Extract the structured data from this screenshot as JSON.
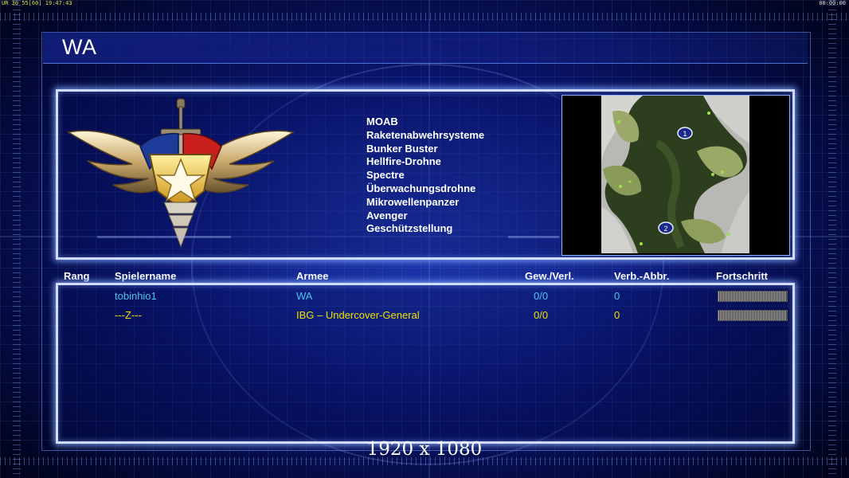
{
  "hud": {
    "top_left": "UR 30 55[60] 19:47:43",
    "top_right": "00:00:00"
  },
  "title": "WA",
  "emblem_icon": "usa-general-wings-emblem",
  "tech_list": [
    "MOAB",
    "Raketenabwehrsysteme",
    "Bunker Buster",
    "Hellfire-Drohne",
    "Spectre",
    "Überwachungsdrohne",
    "Mikrowellenpanzer",
    "Avenger",
    "Geschützstellung"
  ],
  "map": {
    "start_positions": [
      "1",
      "2"
    ]
  },
  "table": {
    "headers": {
      "rank": "Rang",
      "player": "Spielername",
      "army": "Armee",
      "winloss": "Gew./Verl.",
      "disconnects": "Verb.-Abbr.",
      "progress": "Fortschritt"
    },
    "rows": [
      {
        "rank": "",
        "player": "tobinhio1",
        "army": "WA",
        "winloss": "0/0",
        "disconnects": "0",
        "color": "#4fc3ea"
      },
      {
        "rank": "",
        "player": "---Z---",
        "army": "IBG – Undercover-General",
        "winloss": "0/0",
        "disconnects": "0",
        "color": "#f0e000"
      }
    ]
  },
  "resolution_label": "1920 x 1080",
  "colors": {
    "panel_border": "#cfdcff",
    "background": "#0a1670"
  }
}
